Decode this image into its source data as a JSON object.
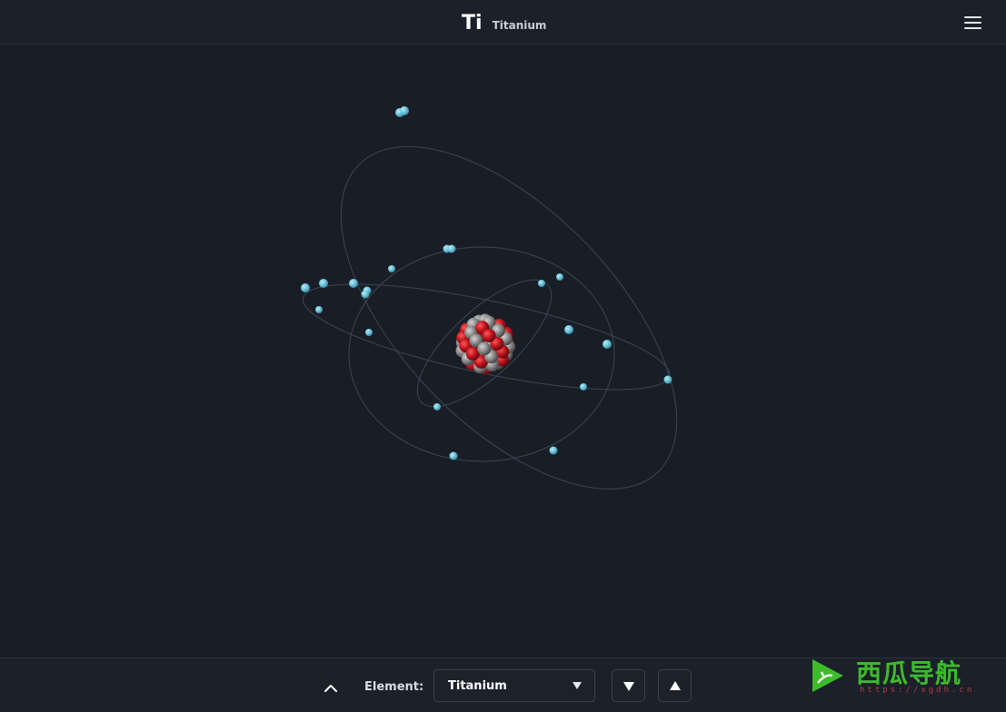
{
  "header": {
    "symbol": "Ti",
    "element_name": "Titanium",
    "menu_icon": "hamburger-menu-icon"
  },
  "controls": {
    "collapse_icon": "chevron-up-icon",
    "element_label": "Element:",
    "selected_element": "Titanium",
    "previous_icon": "triangle-down-icon",
    "next_icon": "triangle-up-icon"
  },
  "atom": {
    "element": "Titanium",
    "protons": 22,
    "neutrons": 26,
    "electron_shells": [
      2,
      8,
      10,
      2
    ],
    "colors": {
      "electron": "#6ec6dd",
      "proton": "#c0141e",
      "neutron": "#8a8a8a",
      "orbit": "#3a4656"
    }
  },
  "watermark": {
    "text": "西瓜导航",
    "url": "https://xgdh.cn",
    "logo_icon": "play-leaf-logo-icon"
  },
  "colors": {
    "background": "#191e26",
    "bar_background": "#1b2029",
    "border": "#2d333d",
    "watermark_green": "#3dbb2c"
  }
}
